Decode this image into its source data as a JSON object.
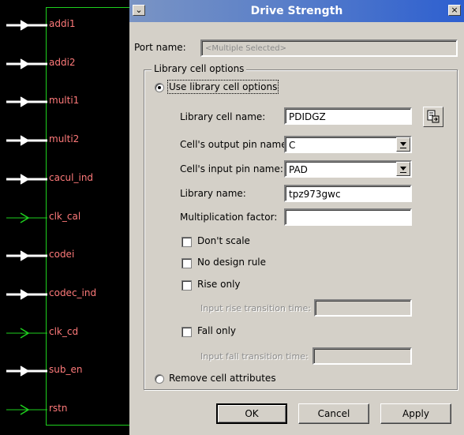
{
  "schematic": {
    "ports": [
      {
        "name": "addi1",
        "type": "input"
      },
      {
        "name": "addi2",
        "type": "input"
      },
      {
        "name": "multi1",
        "type": "input"
      },
      {
        "name": "multi2",
        "type": "input"
      },
      {
        "name": "cacul_ind",
        "type": "input"
      },
      {
        "name": "clk_cal",
        "type": "clock"
      },
      {
        "name": "codei",
        "type": "input"
      },
      {
        "name": "codec_ind",
        "type": "input"
      },
      {
        "name": "clk_cd",
        "type": "clock"
      },
      {
        "name": "sub_en",
        "type": "input"
      },
      {
        "name": "rstn",
        "type": "clock"
      }
    ],
    "colors": {
      "wire": "#ffffff",
      "clock_wire": "#1ed01e",
      "label": "#ff7a7a",
      "block_border": "#1ed01e"
    }
  },
  "dialog": {
    "title": "Drive Strength",
    "port_name_label": "Port name:",
    "port_name_value": "<Multiple Selected>",
    "group_label": "Library cell options",
    "use_lib_label": "Use library cell options",
    "use_lib_selected": true,
    "lib_cell_name_label": "Library cell name:",
    "lib_cell_name_value": "PDIDGZ",
    "output_pin_label": "Cell's output pin name:",
    "output_pin_value": "C",
    "input_pin_label": "Cell's input pin name:",
    "input_pin_value": "PAD",
    "library_name_label": "Library name:",
    "library_name_value": "tpz973gwc",
    "mult_factor_label": "Multiplication factor:",
    "mult_factor_value": "",
    "dont_scale_label": "Don't scale",
    "no_design_rule_label": "No design rule",
    "rise_only_label": "Rise only",
    "rise_transition_label": "Input rise transition time:",
    "rise_transition_value": "",
    "fall_only_label": "Fall only",
    "fall_transition_label": "Input fall transition time:",
    "fall_transition_value": "",
    "remove_attrs_label": "Remove cell attributes",
    "remove_attrs_selected": false,
    "ok_label": "OK",
    "cancel_label": "Cancel",
    "apply_label": "Apply",
    "titlebar_color": "#2d5fd0"
  }
}
